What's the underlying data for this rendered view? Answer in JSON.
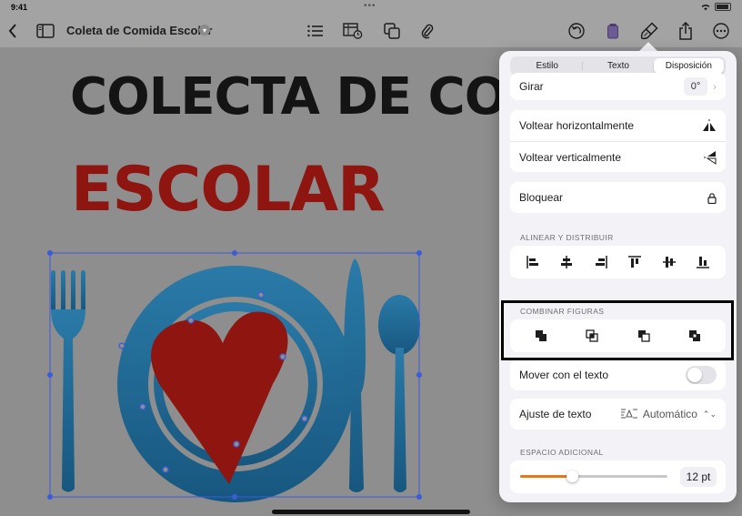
{
  "status": {
    "time": "9:41"
  },
  "document": {
    "title": "Coleta de Comida Escolar"
  },
  "canvas": {
    "line1": "COLECTA DE COMIDA",
    "line2": "ESCOLAR"
  },
  "panel": {
    "tabs": [
      {
        "label": "Estilo",
        "active": false
      },
      {
        "label": "Texto",
        "active": false
      },
      {
        "label": "Disposición",
        "active": true
      }
    ],
    "rotate": {
      "label": "Girar",
      "value": "0°"
    },
    "flip_h": "Voltear horizontalmente",
    "flip_v": "Voltear verticalmente",
    "lock": "Bloquear",
    "align_section": "ALINEAR Y DISTRIBUIR",
    "combine_section": "COMBINAR FIGURAS",
    "move_with_text": "Mover con el texto",
    "text_wrap": {
      "label": "Ajuste de texto",
      "value": "Automático"
    },
    "extra_space_section": "ESPACIO ADICIONAL",
    "extra_space": {
      "value": "12 pt",
      "fraction": 0.34
    }
  },
  "icons": {
    "back": "chevron-left-icon",
    "sidebar": "sidebar-icon",
    "list": "list-icon",
    "table": "table-icon",
    "shapes": "shapes-icon",
    "attach": "paperclip-icon",
    "undo": "undo-icon",
    "doc": "document-icon",
    "format": "paintbrush-icon",
    "share": "share-icon",
    "more": "more-icon"
  },
  "colors": {
    "accent": "#e07b1a",
    "plate": "#1f6e9c",
    "heart": "#8e1510"
  }
}
